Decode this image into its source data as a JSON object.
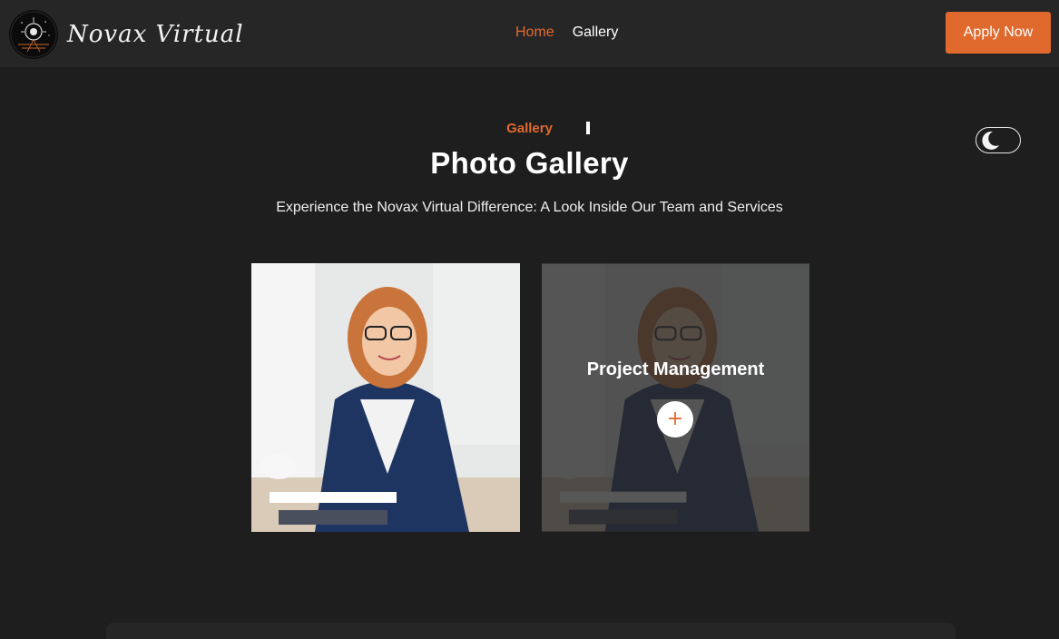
{
  "brand": {
    "name": "Novax Virtual",
    "logo_icon": "compass-sun-emblem-icon"
  },
  "nav": {
    "links": [
      {
        "label": "Home",
        "active": true
      },
      {
        "label": "Gallery",
        "active": false
      }
    ],
    "cta_label": "Apply Now"
  },
  "hero": {
    "eyebrow": "Gallery",
    "title": "Photo Gallery",
    "subtitle": "Experience the Novax Virtual Difference: A Look Inside Our Team and Services"
  },
  "theme_toggle": {
    "icon": "crescent-moon-icon"
  },
  "gallery": {
    "items": [
      {
        "photo_icon": "woman-at-desk-photo"
      },
      {
        "photo_icon": "woman-at-desk-photo",
        "overlay_title": "Project Management",
        "action_symbol": "+"
      }
    ]
  },
  "colors": {
    "accent": "#e06a2e",
    "background": "#1e1e1e",
    "navbar": "#262626",
    "text": "#ffffff"
  }
}
